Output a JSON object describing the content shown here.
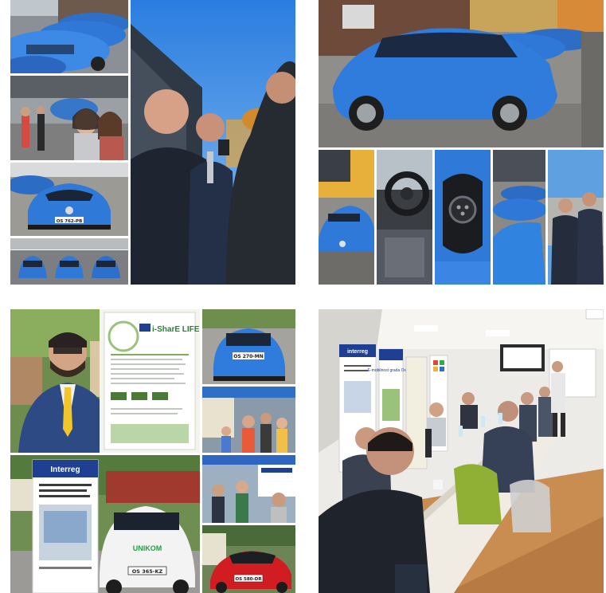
{
  "collages": [
    {
      "name": "collage-renault-zoe-fleet-presentation",
      "tiles": [
        {
          "name": "photo-blue-cars-parked-row",
          "plate": ""
        },
        {
          "name": "photo-group-selfie",
          "plate": ""
        },
        {
          "name": "photo-blue-renault-zoe-front",
          "plate": "OS 762-PB"
        },
        {
          "name": "photo-three-blue-cars-aerial",
          "plate": ""
        },
        {
          "name": "photo-officials-interview",
          "plate": ""
        }
      ]
    },
    {
      "name": "collage-ev-detail-shots",
      "tiles": [
        {
          "name": "photo-blue-renault-zoe-side",
          "plate": ""
        },
        {
          "name": "photo-car-front-row",
          "plate": ""
        },
        {
          "name": "photo-car-interior-steering",
          "plate": ""
        },
        {
          "name": "photo-charging-port",
          "plate": ""
        },
        {
          "name": "photo-car-bonnet-row",
          "plate": ""
        },
        {
          "name": "photo-officials-standing",
          "plate": ""
        }
      ]
    },
    {
      "name": "collage-public-event",
      "tiles": [
        {
          "name": "photo-man-yellow-tie",
          "plate": ""
        },
        {
          "name": "photo-ishare-life-poster",
          "poster_title": "i-SharE LIFE"
        },
        {
          "name": "photo-blue-car-rear",
          "plate": "OS 270-MN"
        },
        {
          "name": "photo-children-at-stand",
          "plate": ""
        },
        {
          "name": "photo-interreg-banner-unikom-car",
          "banner_title": "Interreg",
          "brand": "UNIKOM",
          "plate": "OS 365-KZ"
        },
        {
          "name": "photo-visitors-tent",
          "plate": ""
        },
        {
          "name": "photo-red-tesla",
          "plate": "OS 580-DR"
        }
      ]
    },
    {
      "name": "collage-meeting-room",
      "tiles": [
        {
          "name": "photo-conference-meeting",
          "banner_title": "interreg",
          "banner_subtitle": "E-mobilnost grada Osijeka"
        }
      ]
    }
  ]
}
